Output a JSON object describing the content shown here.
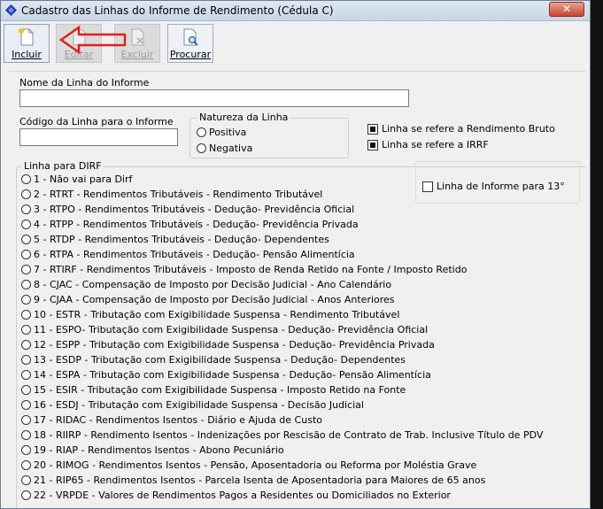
{
  "window": {
    "title": "Cadastro das Linhas do Informe de Rendimento (Cédula C)",
    "close_label": "✕"
  },
  "toolbar": {
    "incluir": "Incluir",
    "editar": "Editar",
    "excluir": "Excluir",
    "procurar": "Procurar"
  },
  "form": {
    "nome_label": "Nome da Linha do Informe",
    "nome_value": "",
    "codigo_label": "Código da Linha para o Informe",
    "codigo_value": "",
    "natureza": {
      "legend": "Natureza da Linha",
      "positiva": "Positiva",
      "negativa": "Negativa"
    },
    "chk_bruto": "Linha se refere a Rendimento Bruto",
    "chk_irrf": "Linha se refere a IRRF",
    "chk_13": "Linha de Informe para 13°",
    "dirf_legend": "Linha para DIRF",
    "dirf_options": [
      "1 - Não vai para Dirf",
      "2 - RTRT - Rendimentos Tributáveis - Rendimento Tributável",
      "3 - RTPO - Rendimentos Tributáveis - Dedução- Previdência Oficial",
      "4 - RTPP - Rendimentos Tributáveis - Dedução- Previdência Privada",
      "5 - RTDP - Rendimentos Tributáveis - Dedução- Dependentes",
      "6 - RTPA - Rendimentos Tributáveis - Dedução- Pensão Alimentícia",
      "7 - RTIRF - Rendimentos Tributáveis - Imposto de Renda Retido na Fonte / Imposto Retido",
      "8 - CJAC - Compensação de Imposto por Decisão Judicial - Ano Calendário",
      "9 - CJAA - Compensação de Imposto por Decisão Judicial - Anos Anteriores",
      "10 - ESTR - Tributação com Exigibilidade Suspensa - Rendimento Tributável",
      "11 - ESPO- Tributação com Exigibilidade Suspensa - Dedução- Previdência Oficial",
      "12 - ESPP - Tributação com Exigibilidade Suspensa - Dedução- Previdência Privada",
      "13 - ESDP - Tributação com Exigibilidade Suspensa - Dedução- Dependentes",
      "14 - ESPA - Tributação com Exigibilidade Suspensa - Dedução- Pensão Alimentícia",
      "15 - ESIR - Tributação com Exigibilidade Suspensa - Imposto Retido na Fonte",
      "16 - ESDJ - Tributação com Exigibilidade Suspensa - Decisão Judicial",
      "17 - RIDAC - Rendimentos Isentos - Diário e Ajuda de Custo",
      "18 - RIIRP - Rendimento Isentos - Indenizações por Rescisão de Contrato de Trab. Inclusive Título de PDV",
      "19 - RIAP - Rendimentos Isentos - Abono Pecuniário",
      "20 - RIMOG - Rendimentos  Isentos - Pensão, Aposentadoria ou Reforma por Moléstia Grave",
      "21 - RIP65 - Rendimentos Isentos - Parcela Isenta de Aposentadoria para Maiores de 65 anos",
      "22 - VRPDE - Valores de Rendimentos Pagos a Residentes ou Domiciliados no Exterior"
    ]
  },
  "colors": {
    "annotation_arrow": "#e02020",
    "title_gradient": "#c9d6e6"
  }
}
